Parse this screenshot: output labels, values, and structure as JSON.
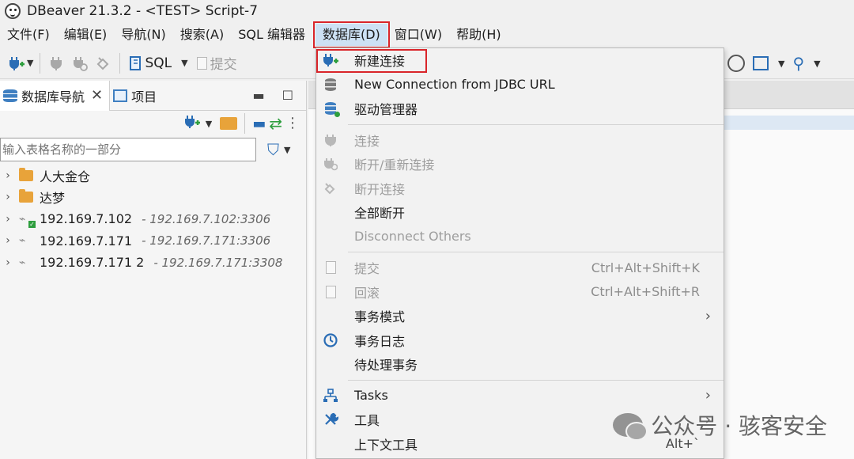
{
  "window": {
    "title": "DBeaver 21.3.2 - <TEST> Script-7"
  },
  "menubar": {
    "items": [
      "文件(F)",
      "编辑(E)",
      "导航(N)",
      "搜索(A)",
      "SQL 编辑器",
      "数据库(D)",
      "窗口(W)",
      "帮助(H)"
    ],
    "active": "数据库(D)"
  },
  "toolbar": {
    "sql_label": "SQL",
    "commit_label": "提交"
  },
  "navigator": {
    "tabs": [
      {
        "label": "数据库导航",
        "active": true,
        "close": "✕"
      },
      {
        "label": "项目",
        "active": false
      }
    ],
    "filter_placeholder": "输入表格名称的一部分",
    "tree": [
      {
        "type": "folder",
        "label": "人大金仓",
        "url": ""
      },
      {
        "type": "folder",
        "label": "达梦",
        "url": ""
      },
      {
        "type": "connection",
        "label": "192.169.7.102",
        "url": "- 192.169.7.102:3306",
        "connected": true
      },
      {
        "type": "connection",
        "label": "192.169.7.171",
        "url": "- 192.169.7.171:3306",
        "connected": false
      },
      {
        "type": "connection",
        "label": "192.169.7.171 2",
        "url": "- 192.169.7.171:3308",
        "connected": false
      }
    ]
  },
  "database_menu": {
    "items": {
      "new_connection": {
        "label": "新建连接",
        "enabled": true,
        "icon": "plug-plus-icon"
      },
      "new_from_jdbc": {
        "label": "New Connection from JDBC URL",
        "enabled": true,
        "icon": "database-icon"
      },
      "driver_manager": {
        "label": "驱动管理器",
        "enabled": true,
        "icon": "database-gear-icon"
      },
      "connect": {
        "label": "连接",
        "enabled": false,
        "icon": "plug-icon"
      },
      "reconnect": {
        "label": "断开/重新连接",
        "enabled": false,
        "icon": "plug-refresh-icon"
      },
      "disconnect": {
        "label": "断开连接",
        "enabled": false,
        "icon": "plug-disconnect-icon"
      },
      "disconnect_all": {
        "label": "全部断开",
        "enabled": true
      },
      "disconnect_others": {
        "label": "Disconnect Others",
        "enabled": false
      },
      "commit": {
        "label": "提交",
        "enabled": false,
        "shortcut": "Ctrl+Alt+Shift+K",
        "icon": "commit-icon"
      },
      "rollback": {
        "label": "回滚",
        "enabled": false,
        "shortcut": "Ctrl+Alt+Shift+R",
        "icon": "rollback-icon"
      },
      "tx_mode": {
        "label": "事务模式",
        "enabled": true,
        "submenu": "›"
      },
      "tx_log": {
        "label": "事务日志",
        "enabled": true,
        "icon": "history-icon"
      },
      "pending_tx": {
        "label": "待处理事务",
        "enabled": true
      },
      "tasks": {
        "label": "Tasks",
        "enabled": true,
        "submenu": "›",
        "icon": "tasks-icon"
      },
      "tools": {
        "label": "工具",
        "enabled": true,
        "submenu": "›",
        "icon": "tools-icon"
      },
      "context_tools": {
        "label": "上下文工具",
        "enabled": true,
        "shortcut": "Alt+`"
      }
    }
  },
  "watermark": {
    "text": "公众号 · 骇客安全"
  },
  "colors": {
    "accent_blue": "#2a6db5",
    "highlight_red": "#d9252a",
    "menu_bg": "#f2f2f2"
  }
}
